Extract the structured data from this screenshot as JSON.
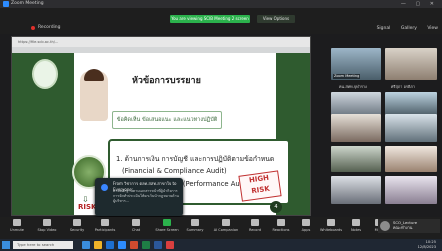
{
  "window": {
    "title": "Zoom Meeting"
  },
  "topbar": {
    "recording": "Recording",
    "banner": "You are viewing SCIB Meeting 2 screen",
    "view_options": "View Options",
    "signals": [
      "Signal",
      "Gallery",
      "View"
    ]
  },
  "browser": {
    "url": "https://file.scb.ac.th/..."
  },
  "slide": {
    "title": "หัวข้อการบรรยาย",
    "subtitle": "ข้อคิดเห็น ข้อเสนอแนะ และแนวทางปฏิบัติ",
    "item1": "1.  ด้านการเงิน การบัญชี และการปฏิบัติตามข้อกำหนด",
    "item1_en": "(Financial & Compliance Audit)",
    "item2": "2.  ด้านการดำเนินงาน (Performance Audit)",
    "stamp": "HIGH RISK",
    "risk_label": "RISK",
    "page_badge": "4"
  },
  "chat": {
    "from": "From วิชาการ ตลท.สสท.สาขาใจ to Everyone:",
    "message": "ตามหลักฐานตามเอกสารหน้าที่ผู้นำกิจการ การจัดทำประเมินให้ยกเว้นนำกฎหมายด้านผู้บริหาร..."
  },
  "participants": {
    "thumbs": [
      {
        "name": "Zoom Meeting"
      },
      {
        "name": ""
      },
      {
        "name": ""
      },
      {
        "name": ""
      },
      {
        "name": ""
      },
      {
        "name": ""
      },
      {
        "name": ""
      },
      {
        "name": ""
      }
    ],
    "labels_row": [
      "คน.สทท.จุฬาราง",
      "ศรีสุภา อรพีภา"
    ]
  },
  "toolbar": {
    "buttons": [
      "Unmute",
      "Stop Video",
      "Security",
      "Participants",
      "Chat",
      "Share Screen",
      "Summary",
      "AI Companion",
      "Record",
      "Reactions",
      "Apps",
      "Whiteboards",
      "Notes",
      "More"
    ],
    "leave": "Leave"
  },
  "self_view": {
    "name": "SCO_Lecture",
    "sub": "คณะทำงาน"
  },
  "taskbar": {
    "search_placeholder": "Type here to search",
    "time": "10:25",
    "date": "12/8/2023"
  }
}
